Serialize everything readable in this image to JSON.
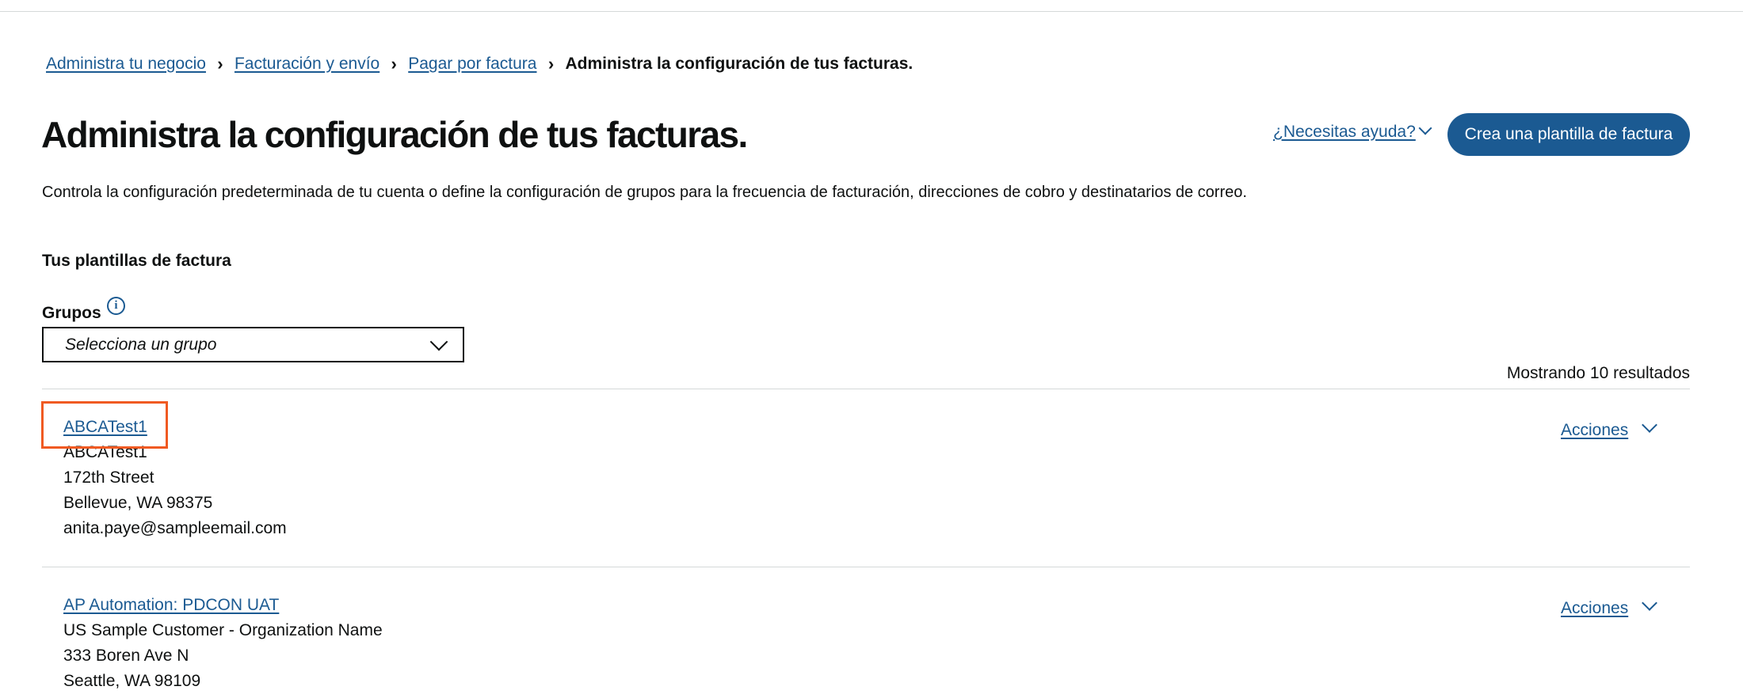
{
  "breadcrumb": {
    "items": [
      "Administra tu negocio",
      "Facturación y envío",
      "Pagar por factura"
    ],
    "current": "Administra la configuración de tus facturas."
  },
  "header": {
    "title": "Administra la configuración de tus facturas.",
    "help_label": "¿Necesitas ayuda?",
    "create_button_label": "Crea una plantilla de factura"
  },
  "description": "Controla la configuración predeterminada de tu cuenta o define la configuración de grupos para la frecuencia de facturación, direcciones de cobro y destinatarios de correo.",
  "templates": {
    "section_title": "Tus plantillas de factura",
    "groups_label": "Grupos",
    "groups_info_icon": "info-icon",
    "groups_select_value": "Selecciona un grupo",
    "results_text": "Mostrando 10 resultados",
    "actions_label": "Acciones",
    "items": [
      {
        "name": "ABCATest1",
        "lines": [
          "ABCATest1",
          "172th Street",
          "Bellevue, WA 98375",
          "anita.paye@sampleemail.com"
        ]
      },
      {
        "name": "AP Automation: PDCON UAT",
        "lines": [
          "US Sample Customer - Organization Name",
          "333 Boren Ave N",
          "Seattle, WA 98109"
        ]
      }
    ]
  },
  "colors": {
    "link": "#1b5a92",
    "button_bg": "#1b5a92",
    "highlight": "#f05a22",
    "divider": "#d5d9d9"
  }
}
